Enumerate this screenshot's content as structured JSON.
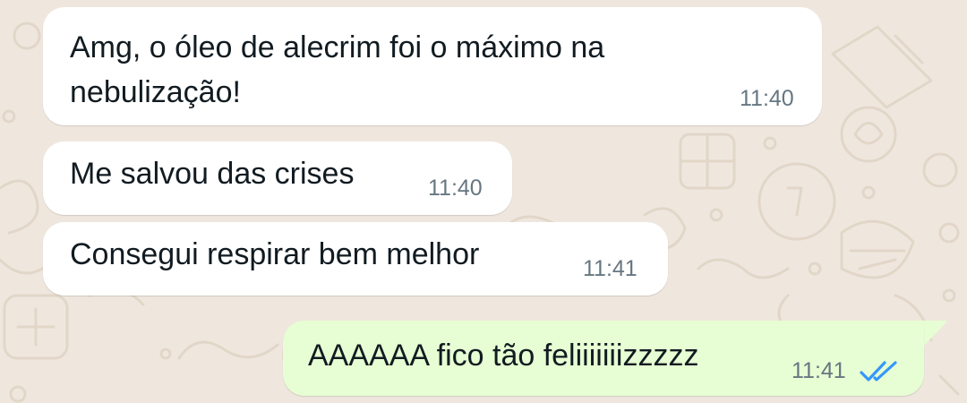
{
  "theme": {
    "wallpaper": "#efe7de",
    "incoming_bubble": "#ffffff",
    "outgoing_bubble": "#e7fdd3",
    "text": "#111b21",
    "timestamp": "#667781",
    "read_ticks": "#3497f9"
  },
  "messages": [
    {
      "direction": "incoming",
      "text_lines": [
        "Amg, o óleo de alecrim foi o máximo na",
        "nebulização!"
      ],
      "time": "11:40"
    },
    {
      "direction": "incoming",
      "text": "Me salvou das crises",
      "time": "11:40"
    },
    {
      "direction": "incoming",
      "text": "Consegui respirar bem melhor",
      "time": "11:41"
    },
    {
      "direction": "outgoing",
      "text": "AAAAAA fico tão  feliiiiiiizzzzz",
      "time": "11:41",
      "status": "read",
      "status_icon": "double-check-icon"
    }
  ]
}
